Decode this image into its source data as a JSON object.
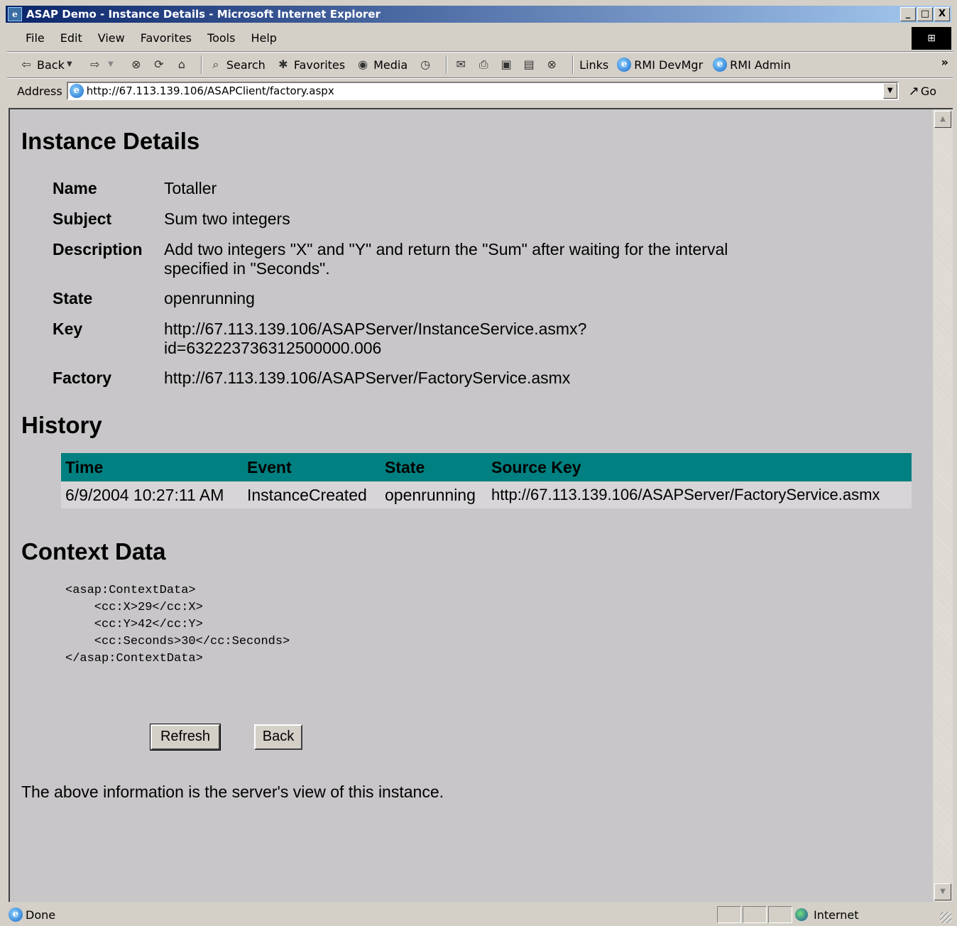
{
  "window": {
    "title": "ASAP Demo - Instance Details - Microsoft Internet Explorer",
    "controls": [
      "_",
      "□",
      "X"
    ]
  },
  "menu": [
    "File",
    "Edit",
    "View",
    "Favorites",
    "Tools",
    "Help"
  ],
  "toolbar": {
    "back": "Back",
    "search": "Search",
    "favorites": "Favorites",
    "media": "Media",
    "links": "Links",
    "link1": "RMI DevMgr",
    "link2": "RMI Admin"
  },
  "address": {
    "label": "Address",
    "url": "http://67.113.139.106/ASAPClient/factory.aspx",
    "go": "Go"
  },
  "page": {
    "title": "Instance Details",
    "details": [
      {
        "label": "Name",
        "value": "Totaller"
      },
      {
        "label": "Subject",
        "value": "Sum two integers"
      },
      {
        "label": "Description",
        "value": "Add two integers \"X\" and \"Y\" and return the \"Sum\" after waiting for the interval specified in \"Seconds\"."
      },
      {
        "label": "State",
        "value": "openrunning"
      },
      {
        "label": "Key",
        "value": "http://67.113.139.106/ASAPServer/InstanceService.asmx? id=632223736312500000.006"
      },
      {
        "label": "Factory",
        "value": "http://67.113.139.106/ASAPServer/FactoryService.asmx"
      }
    ],
    "history_title": "History",
    "history_headers": [
      "Time",
      "Event",
      "State",
      "Source Key"
    ],
    "history_rows": [
      [
        "6/9/2004 10:27:11 AM",
        "InstanceCreated",
        "openrunning",
        "http://67.113.139.106/ASAPServer/FactoryService.asmx"
      ]
    ],
    "context_title": "Context Data",
    "context_xml": "<asap:ContextData>\n    <cc:X>29</cc:X>\n    <cc:Y>42</cc:Y>\n    <cc:Seconds>30</cc:Seconds>\n</asap:ContextData>",
    "refresh_button": "Refresh",
    "back_button": "Back",
    "footer": "The above information is the server's view of this instance."
  },
  "status": {
    "text": "Done",
    "zone": "Internet"
  }
}
